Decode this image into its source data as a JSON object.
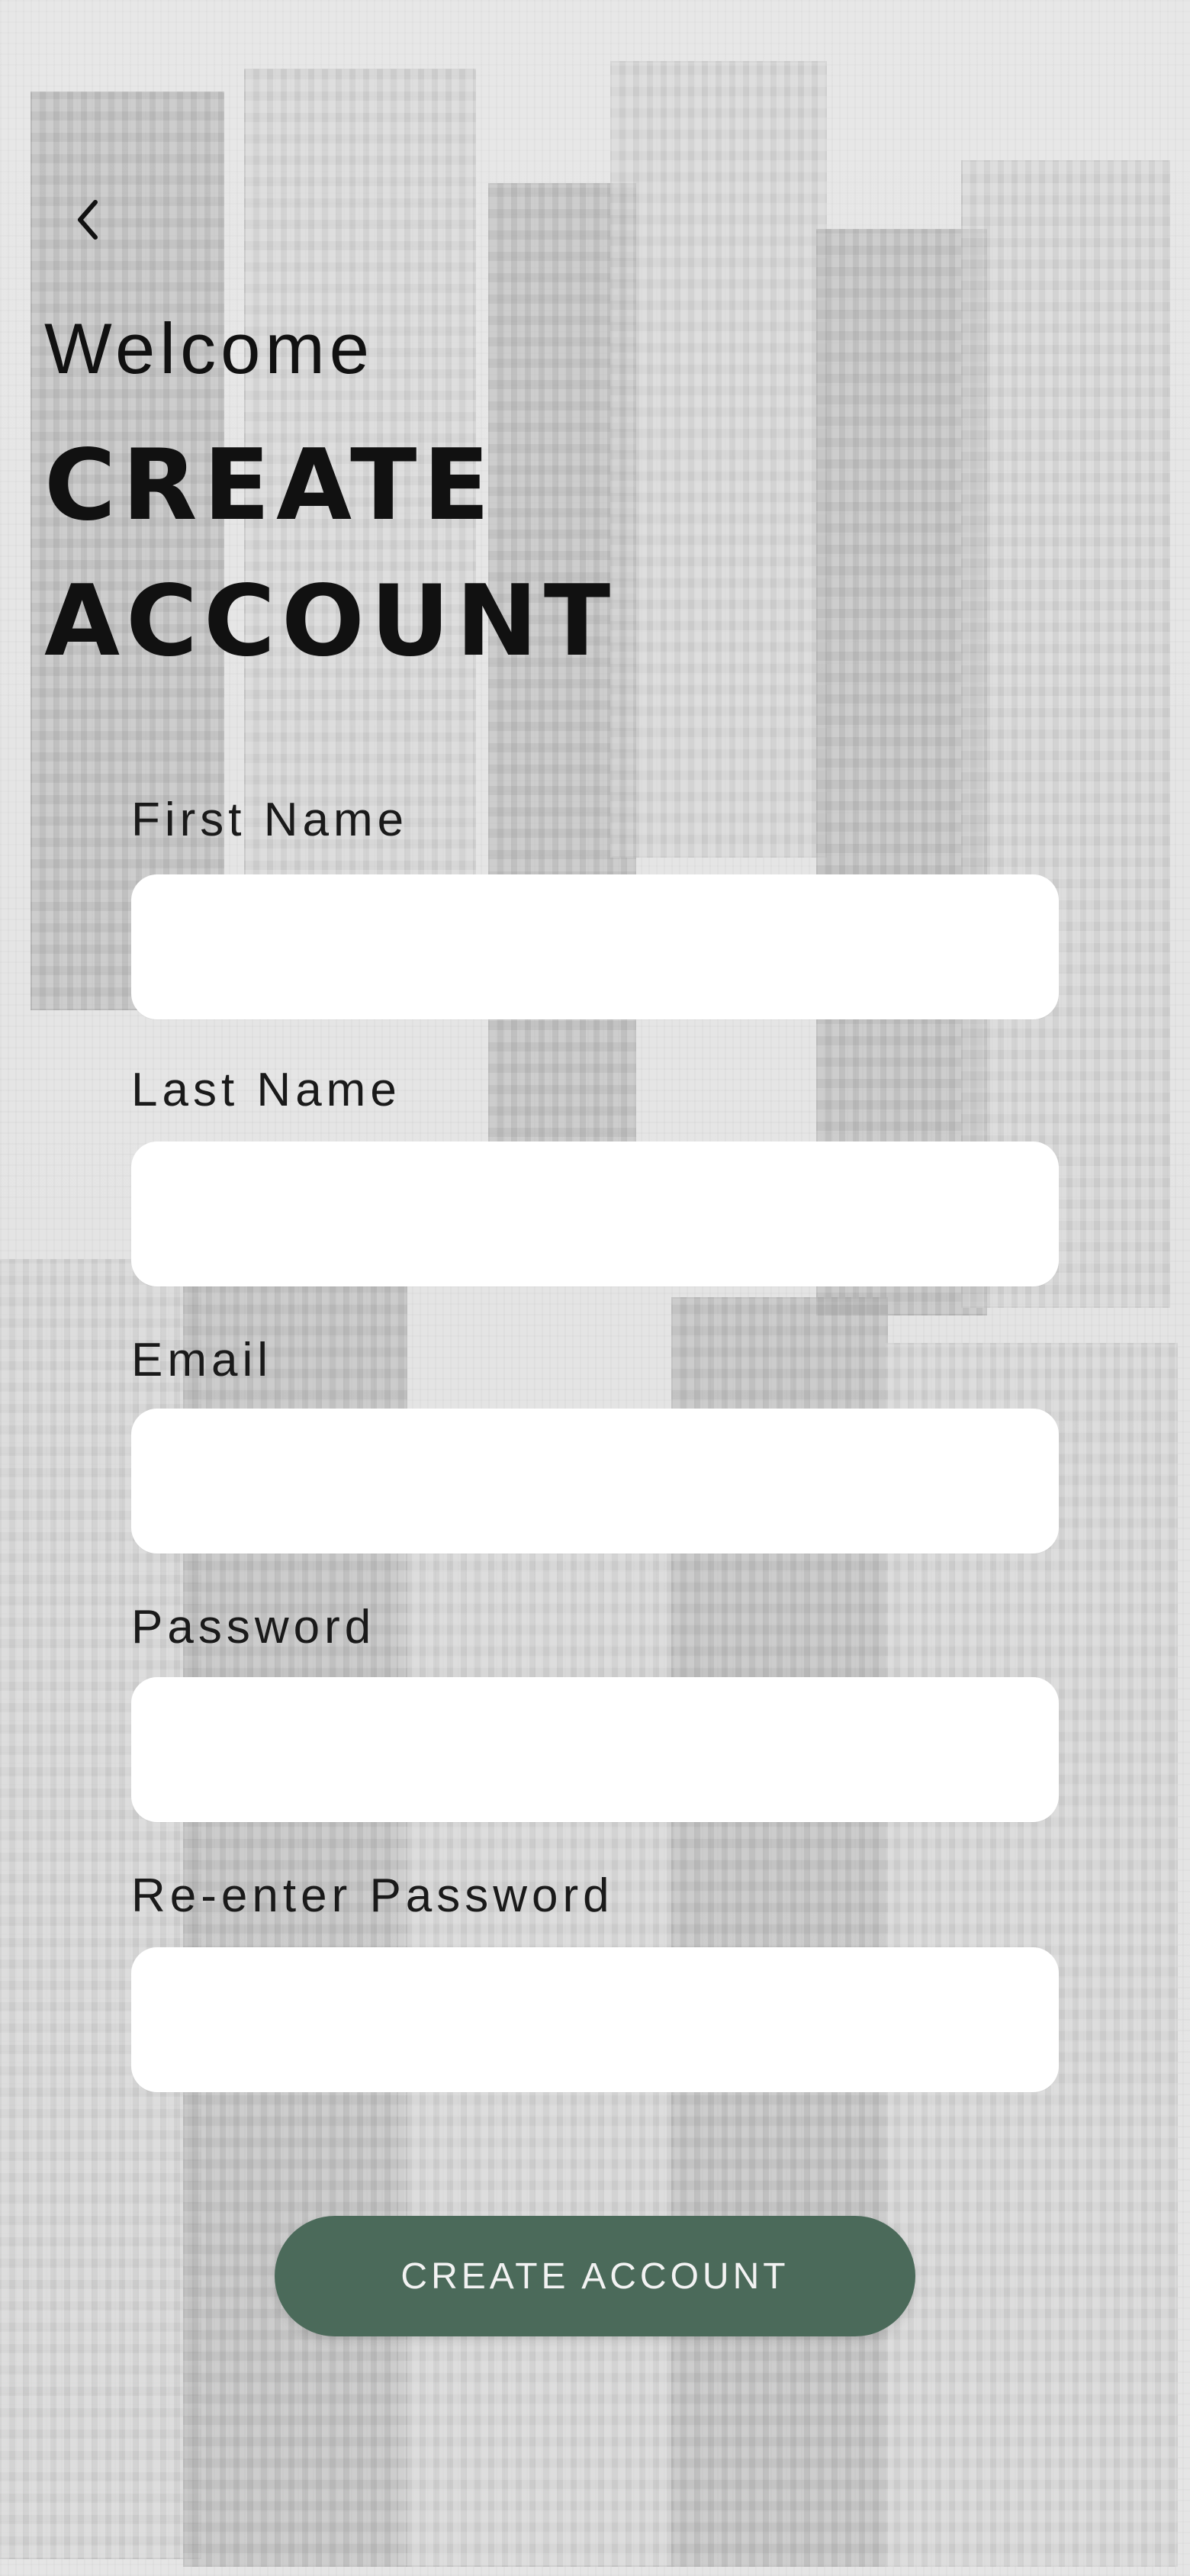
{
  "header": {
    "welcome_text": "Welcome",
    "title_text": "CREATE\nACCOUNT"
  },
  "icons": {
    "back": "chevron-left-icon"
  },
  "form": {
    "fields": [
      {
        "label": "First Name",
        "value": "",
        "placeholder": ""
      },
      {
        "label": "Last Name",
        "value": "",
        "placeholder": ""
      },
      {
        "label": "Email",
        "value": "",
        "placeholder": ""
      },
      {
        "label": "Password",
        "value": "",
        "placeholder": ""
      },
      {
        "label": "Re-enter Password",
        "value": "",
        "placeholder": ""
      }
    ]
  },
  "actions": {
    "create_account_label": "CREATE ACCOUNT"
  },
  "colors": {
    "primary_button": "#4b6a5a",
    "text_primary": "#111111",
    "field_background": "#ffffff"
  }
}
